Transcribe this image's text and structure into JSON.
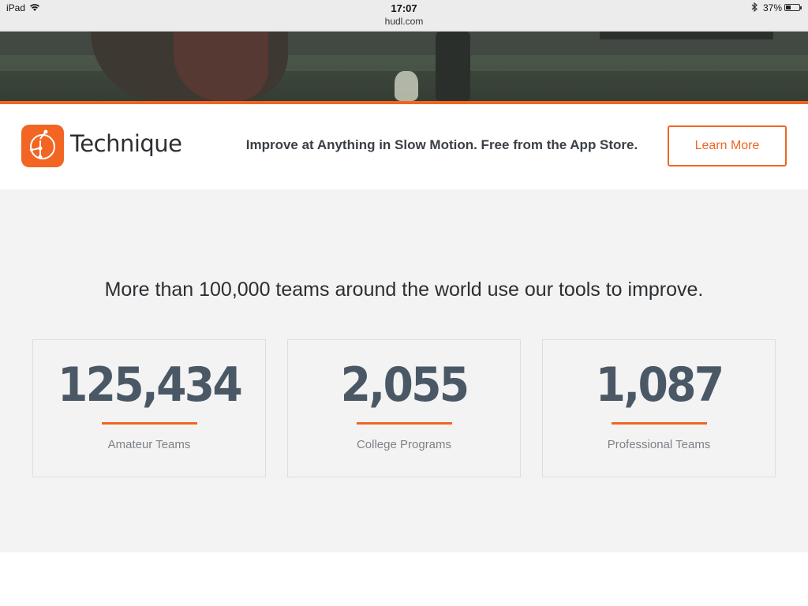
{
  "status_bar": {
    "device": "iPad",
    "time": "17:07",
    "url": "hudl.com",
    "battery_percent": "37%",
    "battery_level": 0.37,
    "icons": [
      "wifi-icon",
      "bluetooth-icon",
      "battery-icon"
    ]
  },
  "banner": {
    "app_name": "Technique",
    "tagline": "Improve at Anything in Slow Motion. Free from the App Store.",
    "button_label": "Learn More",
    "accent_color": "#f26522"
  },
  "stats": {
    "headline": "More than 100,000 teams around the world use our tools to improve.",
    "items": [
      {
        "value": "125,434",
        "label": "Amateur Teams"
      },
      {
        "value": "2,055",
        "label": "College Programs"
      },
      {
        "value": "1,087",
        "label": "Professional Teams"
      }
    ]
  }
}
